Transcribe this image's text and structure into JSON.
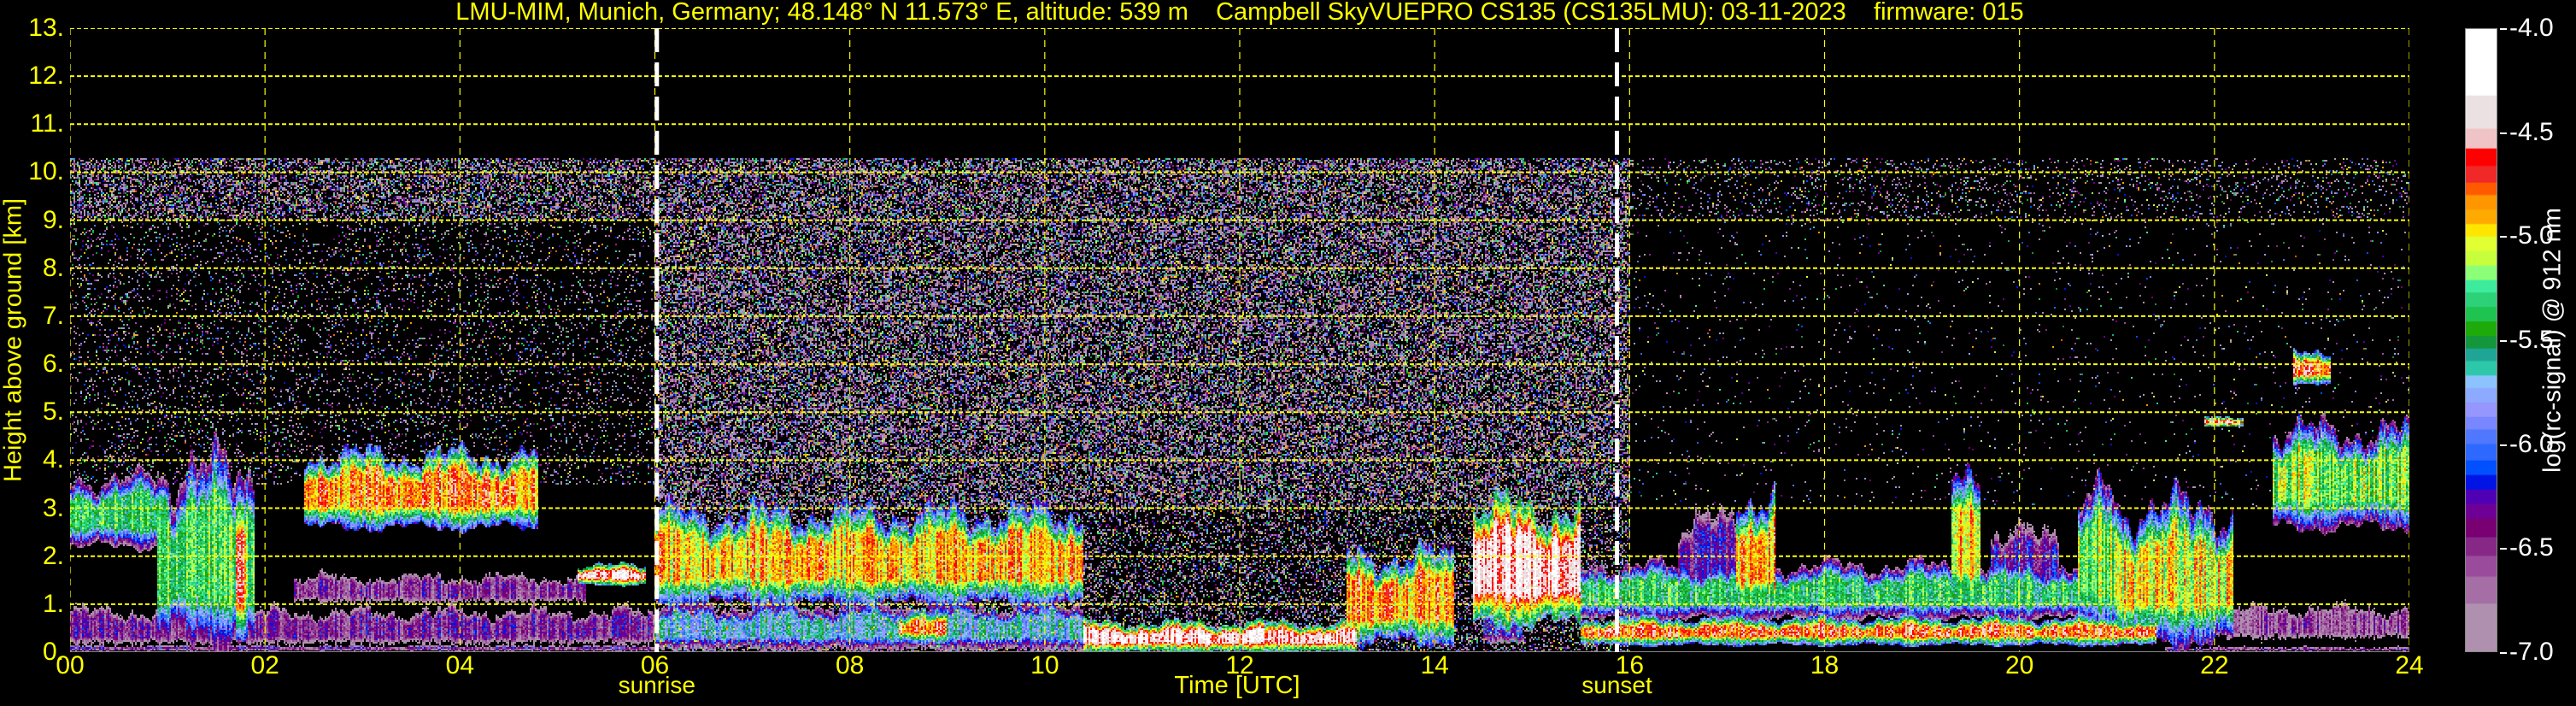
{
  "chart_data": {
    "type": "heatmap",
    "title": "LMU-MIM, Munich, Germany; 48.148° N 11.573° E, altitude: 539 m    Campbell SkyVUEPRO CS135 (CS135LMU): 03-11-2023    firmware: 015",
    "xlabel": "Time [UTC]",
    "ylabel": "Height above ground [km]",
    "xlim": [
      0,
      24
    ],
    "ylim": [
      0,
      13
    ],
    "x_ticks": [
      "00",
      "02",
      "04",
      "06",
      "08",
      "10",
      "12",
      "14",
      "16",
      "18",
      "20",
      "22",
      "24"
    ],
    "x_tick_values": [
      0,
      2,
      4,
      6,
      8,
      10,
      12,
      14,
      16,
      18,
      20,
      22,
      24
    ],
    "y_ticks": [
      "0.",
      "1.",
      "2.",
      "3.",
      "4.",
      "5.",
      "6.",
      "7.",
      "8.",
      "9.",
      "10.",
      "11.",
      "12.",
      "13."
    ],
    "y_tick_values": [
      0,
      1,
      2,
      3,
      4,
      5,
      6,
      7,
      8,
      9,
      10,
      11,
      12,
      13
    ],
    "grid": true,
    "annotations": [
      {
        "label": "sunrise",
        "time": 6.02
      },
      {
        "label": "sunset",
        "time": 15.87
      }
    ],
    "colorbar": {
      "label": "log(rc-signal) @ 912 nm",
      "range": [
        -7.0,
        -4.0
      ],
      "ticks": [
        "-4.0",
        "-4.5",
        "-5.0",
        "-5.5",
        "-6.0",
        "-6.5",
        "-7.0"
      ],
      "tick_values": [
        -4.0,
        -4.5,
        -5.0,
        -5.5,
        -6.0,
        -6.5,
        -7.0
      ],
      "colors": [
        "#ffffff",
        "#ebe1e3",
        "#f0c4c6",
        "#ff0000",
        "#f02828",
        "#ff5a00",
        "#ff9600",
        "#ffaa00",
        "#ffe600",
        "#e1ff32",
        "#c8ff3c",
        "#8cff78",
        "#3ceb9b",
        "#2dd278",
        "#1ec350",
        "#1eaa0a",
        "#14963c",
        "#1ea596",
        "#2dc8aa",
        "#8cc3ff",
        "#8caaff",
        "#9696ff",
        "#7887ff",
        "#5078ff",
        "#2d69ff",
        "#0050ff",
        "#0014e6",
        "#5000b4",
        "#6e0096",
        "#780073",
        "#872887",
        "#9b4b9b",
        "#a56ea5",
        "#af91af"
      ],
      "lower_bounds": [
        -4.32,
        -4.48,
        -4.576,
        -4.66,
        -4.74,
        -4.8,
        -4.87,
        -4.94,
        -5.0,
        -5.07,
        -5.14,
        -5.21,
        -5.27,
        -5.34,
        -5.41,
        -5.48,
        -5.54,
        -5.6,
        -5.67,
        -5.73,
        -5.8,
        -5.87,
        -5.93,
        -6.0,
        -6.08,
        -6.15,
        -6.22,
        -6.29,
        -6.36,
        -6.45,
        -6.54,
        -6.64,
        -6.77,
        -7.0
      ]
    },
    "max_signal_height_km": 10.3,
    "layers_note": "approximate backscatter features: [t_start_h, t_end_h, base_km, top_km, peak_log_signal]",
    "layers": [
      [
        0,
        6,
        0,
        1.0,
        -6.45
      ],
      [
        0,
        6,
        0,
        0.15,
        -6.0
      ],
      [
        2.3,
        5.3,
        0.9,
        1.7,
        -6.5
      ],
      [
        0,
        1.0,
        2.2,
        3.6,
        -5.4
      ],
      [
        0.9,
        1.9,
        0.2,
        3.8,
        -5.3
      ],
      [
        1.7,
        1.8,
        0.2,
        3.4,
        -4.7
      ],
      [
        2.4,
        4.8,
        2.6,
        4.1,
        -4.8
      ],
      [
        5.2,
        5.9,
        1.4,
        1.8,
        -4.4
      ],
      [
        6,
        10.4,
        0,
        1.0,
        -5.7
      ],
      [
        6,
        10.4,
        1.0,
        2.9,
        -4.9
      ],
      [
        8.5,
        9,
        0.2,
        0.8,
        -4.7
      ],
      [
        10.4,
        13.2,
        0,
        0.6,
        -4.4
      ],
      [
        13.1,
        14.2,
        0.2,
        2.0,
        -4.8
      ],
      [
        14.4,
        15.5,
        0.6,
        3.0,
        -4.4
      ],
      [
        14.5,
        14.9,
        0.1,
        1.0,
        -6.2
      ],
      [
        15.5,
        21.4,
        0.7,
        1.8,
        -5.4
      ],
      [
        15.5,
        21.4,
        0.15,
        0.7,
        -4.7
      ],
      [
        16.5,
        17.1,
        0.8,
        3.0,
        -6.3
      ],
      [
        17.1,
        17.5,
        0.8,
        3.2,
        -4.9
      ],
      [
        19.3,
        19.6,
        1.0,
        3.5,
        -5.0
      ],
      [
        19.7,
        20.4,
        0.8,
        2.7,
        -6.3
      ],
      [
        20.6,
        21.0,
        0.5,
        3.2,
        -5.2
      ],
      [
        21.0,
        22.2,
        0.2,
        3.0,
        -5.0
      ],
      [
        21.5,
        24,
        0.1,
        1.1,
        -6.6
      ],
      [
        21.5,
        24,
        0,
        0.12,
        -6.0
      ],
      [
        22.6,
        24,
        2.6,
        4.6,
        -5.2
      ],
      [
        22.8,
        23.2,
        5.6,
        6.2,
        -4.7
      ],
      [
        21.9,
        22.3,
        4.7,
        4.9,
        -4.3
      ]
    ],
    "noise_note": "[t_start_h, t_end_h, base_km, top_km, fraction_of_bins_with_signal]",
    "noise": [
      [
        0,
        6,
        9,
        10.3,
        0.45
      ],
      [
        0,
        6,
        3.5,
        9,
        0.12
      ],
      [
        6,
        16,
        3,
        10.3,
        0.5
      ],
      [
        6,
        16,
        0,
        3,
        0.3
      ],
      [
        16,
        24,
        9,
        10.3,
        0.12
      ],
      [
        16,
        24,
        3,
        9,
        0.02
      ]
    ],
    "grid_color": "#ffff00",
    "text_color": "#ffff00"
  }
}
